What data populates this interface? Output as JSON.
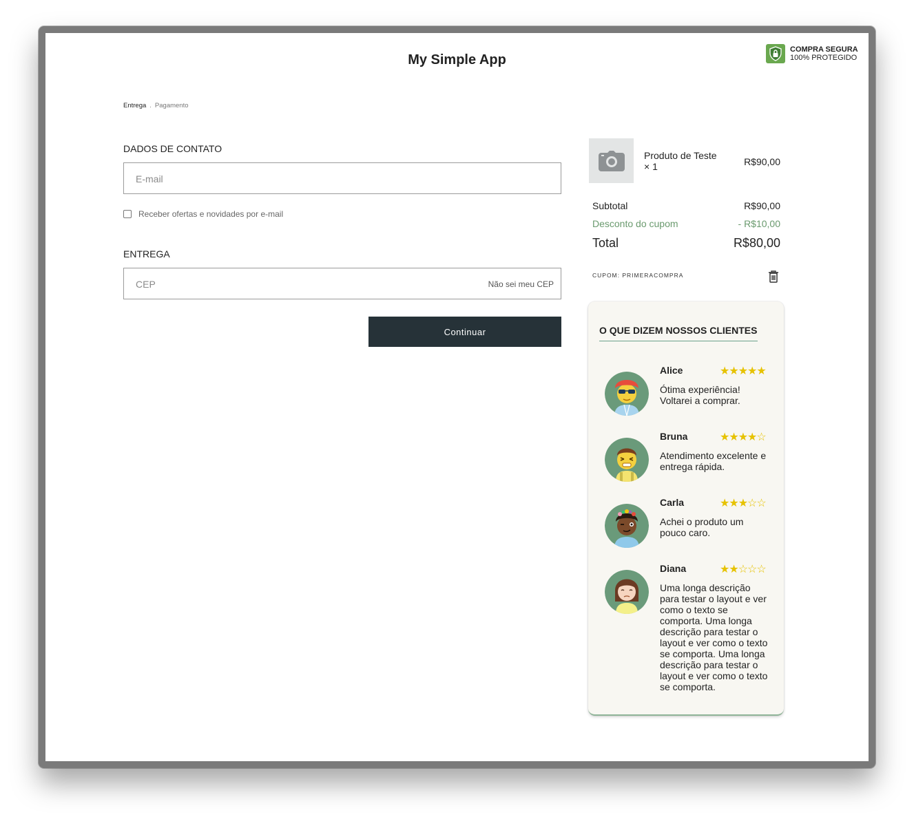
{
  "header": {
    "title": "My Simple App",
    "secure_line1": "COMPRA SEGURA",
    "secure_line2": "100% PROTEGIDO",
    "shield_icon": "shield-lock-icon"
  },
  "breadcrumb": {
    "current": "Entrega",
    "separator": ".",
    "next": "Pagamento"
  },
  "contact": {
    "title": "DADOS DE CONTATO",
    "email_placeholder": "E-mail",
    "email_value": "",
    "newsletter_label": "Receber ofertas e novidades por e-mail",
    "newsletter_checked": false
  },
  "delivery": {
    "title": "ENTREGA",
    "cep_placeholder": "CEP",
    "cep_value": "",
    "cep_help": "Não sei meu CEP"
  },
  "continue_label": "Continuar",
  "summary": {
    "product_name": "Produto de Teste",
    "product_qty": "× 1",
    "product_price": "R$90,00",
    "subtotal_label": "Subtotal",
    "subtotal_value": "R$90,00",
    "discount_label": "Desconto do cupom",
    "discount_value": "- R$10,00",
    "total_label": "Total",
    "total_value": "R$80,00",
    "coupon_label": "CUPOM: PRIMERACOMPRA"
  },
  "testimonials": {
    "title": "O QUE DIZEM NOSSOS CLIENTES",
    "reviews": [
      {
        "name": "Alice",
        "stars": "★★★★★",
        "rating": 5,
        "text": "Ótima experiência! Voltarei a comprar."
      },
      {
        "name": "Bruna",
        "stars": "★★★★☆",
        "rating": 4,
        "text": "Atendimento excelente e entrega rápida."
      },
      {
        "name": "Carla",
        "stars": "★★★☆☆",
        "rating": 3,
        "text": "Achei o produto um pouco caro."
      },
      {
        "name": "Diana",
        "stars": "★★☆☆☆",
        "rating": 2,
        "text": "Uma longa descrição para testar o layout e ver como o texto se comporta. Uma longa descrição para testar o layout e ver como o texto se comporta. Uma longa descrição para testar o layout e ver como o texto se comporta."
      }
    ]
  },
  "colors": {
    "button_bg": "#263238",
    "discount_green": "#6a9a6e",
    "shield_green": "#6aa84f",
    "star_yellow": "#e6c200",
    "avatar_bg": "#6a9a7a"
  }
}
